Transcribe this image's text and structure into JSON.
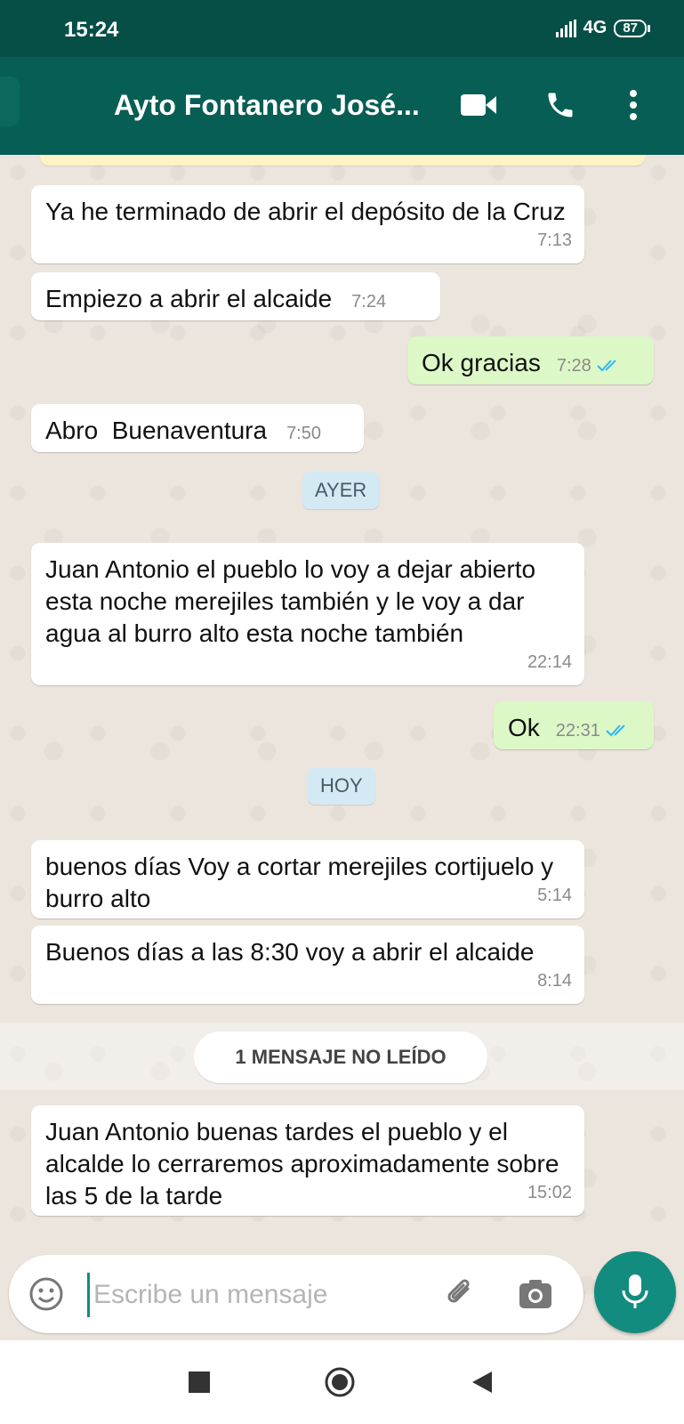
{
  "status_bar": {
    "time": "15:24",
    "network": "4G",
    "battery": "87"
  },
  "header": {
    "title": "Ayto Fontanero José..."
  },
  "messages": [
    {
      "dir": "in",
      "text": "Ya he terminado de abrir el depósito de la Cruz",
      "time": "7:13"
    },
    {
      "dir": "in",
      "text": "Empiezo a abrir el alcaide",
      "time": "7:24"
    },
    {
      "dir": "out",
      "text": "Ok gracias",
      "time": "7:28"
    },
    {
      "dir": "in",
      "text": "Abro  Buenaventura",
      "time": "7:50"
    },
    {
      "dir": "in",
      "text": "Juan Antonio el pueblo lo voy a dejar abierto esta noche merejiles también y le voy a dar agua al burro alto esta noche también",
      "time": "22:14"
    },
    {
      "dir": "out",
      "text": "Ok",
      "time": "22:31"
    },
    {
      "dir": "in",
      "text": "buenos días Voy a cortar merejiles cortijuelo y burro alto",
      "time": "5:14"
    },
    {
      "dir": "in",
      "text": "Buenos días a las 8:30 voy a abrir el alcaide",
      "time": "8:14"
    },
    {
      "dir": "in",
      "text": "Juan Antonio buenas tardes el pueblo y el alcalde lo cerraremos aproximadamente sobre las 5 de la tarde",
      "time": "15:02"
    }
  ],
  "date_separators": {
    "yesterday": "AYER",
    "today": "HOY"
  },
  "unread_label": "1 MENSAJE NO LEÍDO",
  "composer": {
    "placeholder": "Escribe un mensaje"
  },
  "colors": {
    "header": "#075e54",
    "outgoing": "#dcf8c6",
    "accent": "#128c7e",
    "ticks": "#34b7f1"
  },
  "icons": [
    "video-call-icon",
    "voice-call-icon",
    "more-options-icon",
    "emoji-icon",
    "attach-icon",
    "camera-icon",
    "mic-icon",
    "double-check-icon"
  ]
}
